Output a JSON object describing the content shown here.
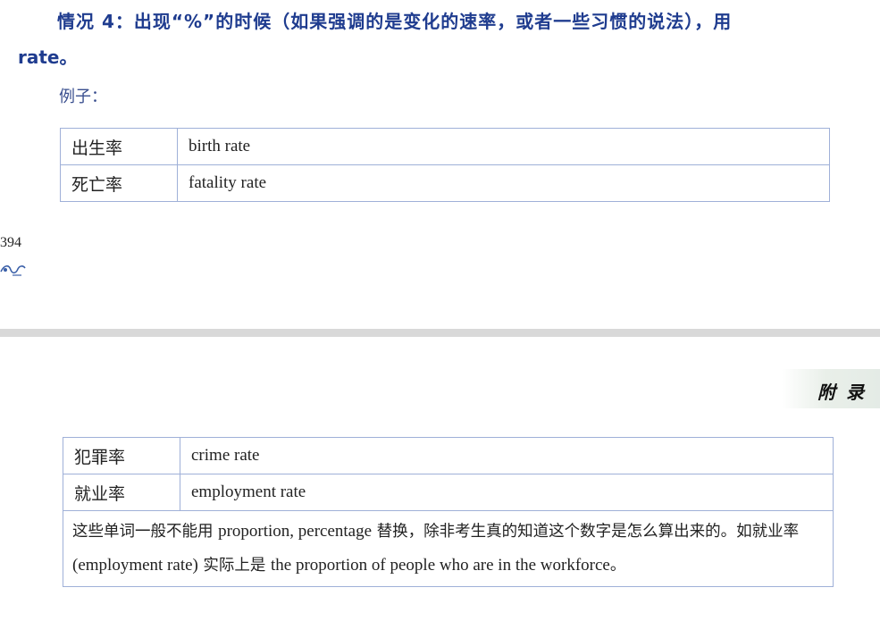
{
  "top_page": {
    "situation_title": "情况 4：出现“%”的时候（如果强调的是变化的速率，或者一些习惯的说法），用",
    "situation_cont": "rate。",
    "example_label": "例子：",
    "rows": [
      {
        "zh": "出生率",
        "en": "birth rate"
      },
      {
        "zh": "死亡率",
        "en": "fatality rate"
      }
    ],
    "page_number": "394"
  },
  "bottom_page": {
    "header_label": "附录",
    "rows": [
      {
        "zh": "犯罪率",
        "en": "crime rate"
      },
      {
        "zh": "就业率",
        "en": "employment rate"
      }
    ],
    "note": {
      "p1": "这些单词一般不能用 ",
      "p2": "proportion, percentage",
      "p3": " 替换，除非考生真的知道这个数字是怎么算出来的。如就业率 ",
      "p4": "(employment rate)",
      "p5": " 实际上是 ",
      "p6": "the proportion of people who are in the workforce",
      "p7": "。"
    }
  },
  "colors": {
    "title_blue": "#1f3c8f",
    "table_border": "#7d8fc0",
    "page_gap": "#d9d9d9"
  }
}
